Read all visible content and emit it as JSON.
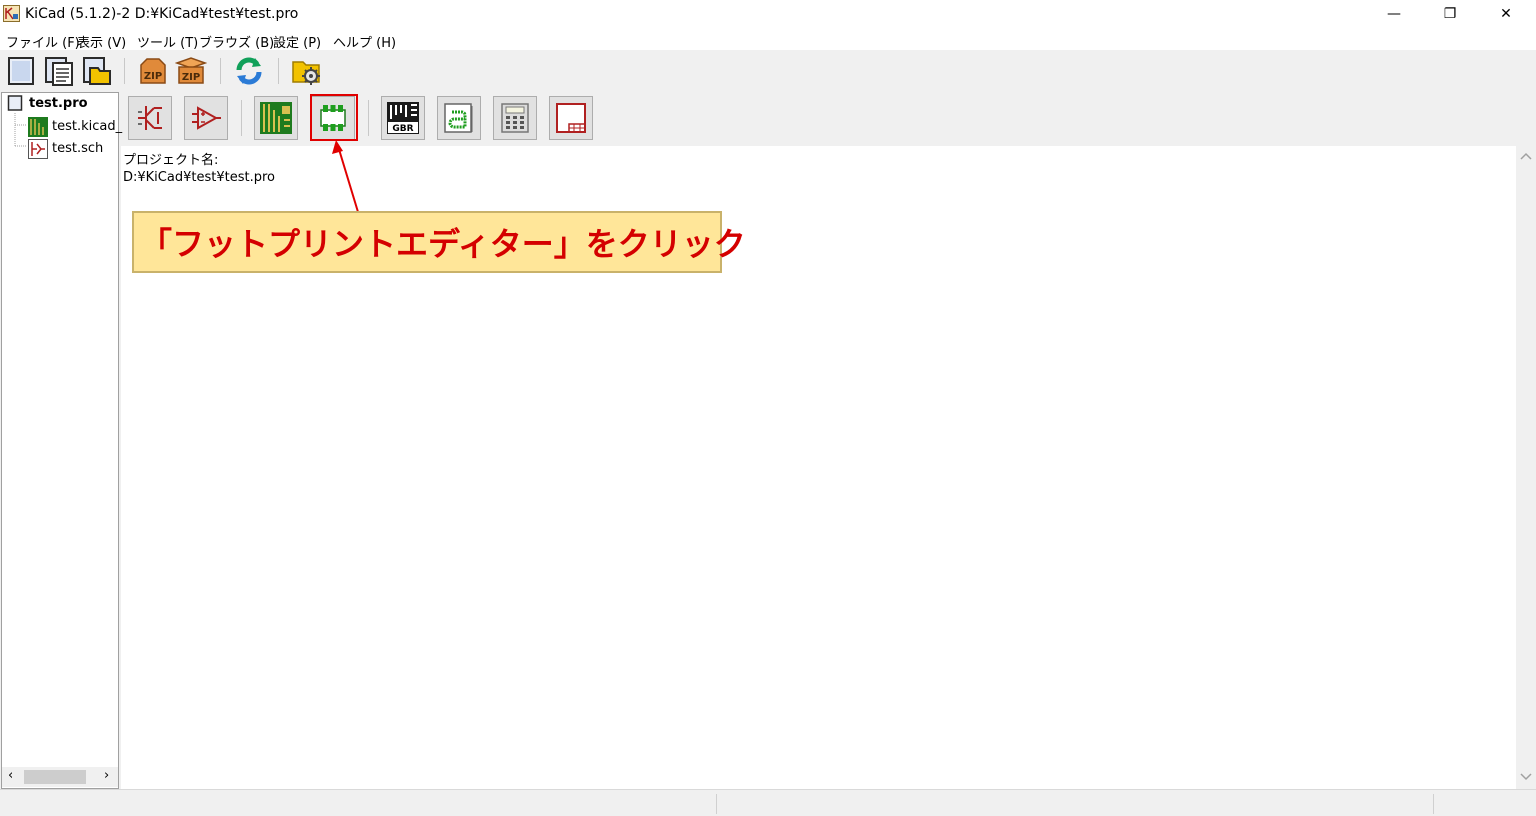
{
  "window": {
    "title": "KiCad (5.1.2)-2 D:¥KiCad¥test¥test.pro",
    "minimize_glyph": "—",
    "restore_glyph": "❐",
    "close_glyph": "✕"
  },
  "menu": [
    {
      "label": "ファイル (F)"
    },
    {
      "label": "表示 (V)"
    },
    {
      "label": "ツール (T)"
    },
    {
      "label": "ブラウズ (B)"
    },
    {
      "label": "設定 (P)"
    },
    {
      "label": "ヘルプ (H)"
    }
  ],
  "toolbar": {
    "icons": [
      "new-project-icon",
      "new-from-template-icon",
      "open-project-icon",
      "archive-zip-icon",
      "unarchive-zip-icon",
      "refresh-icon",
      "project-settings-icon"
    ],
    "zip_label": "ZIP"
  },
  "tree": {
    "items": [
      {
        "label": "test.pro",
        "icon": "project-file-icon"
      },
      {
        "label": "test.kicad_",
        "icon": "pcb-file-icon"
      },
      {
        "label": "test.sch",
        "icon": "schematic-file-icon"
      }
    ]
  },
  "launcher": {
    "buttons": [
      "schematic-editor-icon",
      "symbol-editor-icon",
      "pcb-editor-icon",
      "footprint-editor-icon",
      "gerber-viewer-icon",
      "bitmap-converter-icon",
      "calculator-icon",
      "page-layout-editor-icon"
    ],
    "gbr_label": "GBR"
  },
  "info": {
    "project_label": "プロジェクト名:",
    "project_path": "D:¥KiCad¥test¥test.pro"
  },
  "callout": {
    "text": "「フットプリントエディター」をクリック"
  },
  "colors": {
    "annotation_red": "#e00000",
    "callout_bg": "#ffe699",
    "pcb_green": "#1e7b1e"
  }
}
